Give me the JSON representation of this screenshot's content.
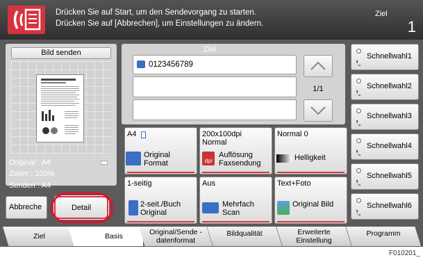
{
  "header": {
    "line1": "Drücken Sie auf Start, um den Sendevorgang zu starten.",
    "line2": "Drücken Sie auf [Abbrechen], um Einstellungen zu ändern.",
    "ziel_label": "Ziel",
    "ziel_count": "1"
  },
  "preview": {
    "title": "Bild senden",
    "original": "Original  : A4",
    "zoom": "Zoom     : 100%",
    "senden": "Senden   : A4",
    "cancel": "Abbreche",
    "detail": "Detail"
  },
  "destination": {
    "title": "Ziel",
    "entry1": "0123456789",
    "page": "1/1"
  },
  "settings": [
    {
      "value": "A4",
      "label": "Original Format"
    },
    {
      "value": "200x100dpi Normal",
      "label": "Auflösung Faxsendung"
    },
    {
      "value": "Normal 0",
      "label": "Helligkeit"
    },
    {
      "value": "1-seitig",
      "label": "2-seit./Buch Original"
    },
    {
      "value": "Aus",
      "label": "Mehrfach Scan"
    },
    {
      "value": "Text+Foto",
      "label": "Original Bild"
    }
  ],
  "quick": [
    "Schnellwahl1",
    "Schnellwahl2",
    "Schnellwahl3",
    "Schnellwahl4",
    "Schnellwahl5",
    "Schnellwahl6"
  ],
  "tabs": [
    "Ziel",
    "Basis",
    "Original/Sende -datenformat",
    "Bildqualität",
    "Erweiterte Einstellung",
    "Programm"
  ],
  "footer_code": "F010201_",
  "colors": {
    "accent": "#d7333f",
    "panel": "#cfcfcf",
    "background": "#5b5b5b"
  }
}
